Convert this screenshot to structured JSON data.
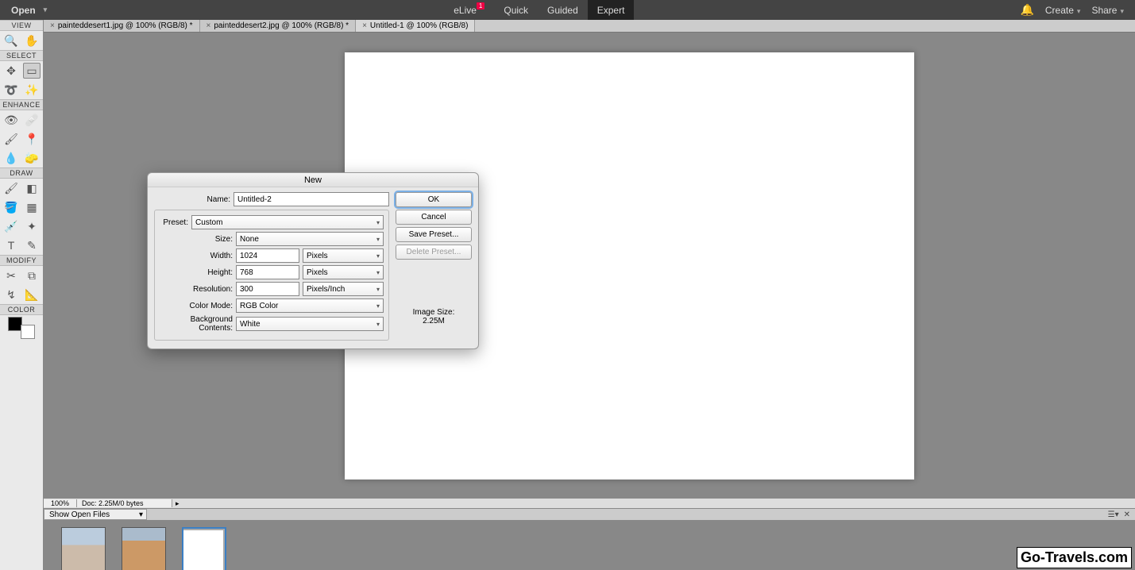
{
  "topbar": {
    "open_label": "Open",
    "modes": {
      "elive": "eLive",
      "elive_badge": "1",
      "quick": "Quick",
      "guided": "Guided",
      "expert": "Expert"
    },
    "create_label": "Create",
    "share_label": "Share"
  },
  "tool_sections": {
    "view": "VIEW",
    "select": "SELECT",
    "enhance": "ENHANCE",
    "draw": "DRAW",
    "modify": "MODIFY",
    "color": "COLOR"
  },
  "doc_tabs": [
    {
      "label": "painteddesert1.jpg @ 100% (RGB/8) *"
    },
    {
      "label": "painteddesert2.jpg @ 100% (RGB/8) *"
    },
    {
      "label": "Untitled-1 @ 100% (RGB/8)"
    }
  ],
  "status": {
    "zoom": "100%",
    "doc": "Doc: 2.25M/0 bytes"
  },
  "openfiles_label": "Show Open Files",
  "dialog": {
    "title": "New",
    "name_label": "Name:",
    "name_value": "Untitled-2",
    "preset_label": "Preset:",
    "preset_value": "Custom",
    "size_label": "Size:",
    "size_value": "None",
    "width_label": "Width:",
    "width_value": "1024",
    "width_unit": "Pixels",
    "height_label": "Height:",
    "height_value": "768",
    "height_unit": "Pixels",
    "res_label": "Resolution:",
    "res_value": "300",
    "res_unit": "Pixels/Inch",
    "mode_label": "Color Mode:",
    "mode_value": "RGB Color",
    "bg_label": "Background Contents:",
    "bg_value": "White",
    "ok": "OK",
    "cancel": "Cancel",
    "save_preset": "Save Preset...",
    "delete_preset": "Delete Preset...",
    "imgsz_label": "Image Size:",
    "imgsz_value": "2.25M"
  },
  "watermark": "Go-Travels.com"
}
